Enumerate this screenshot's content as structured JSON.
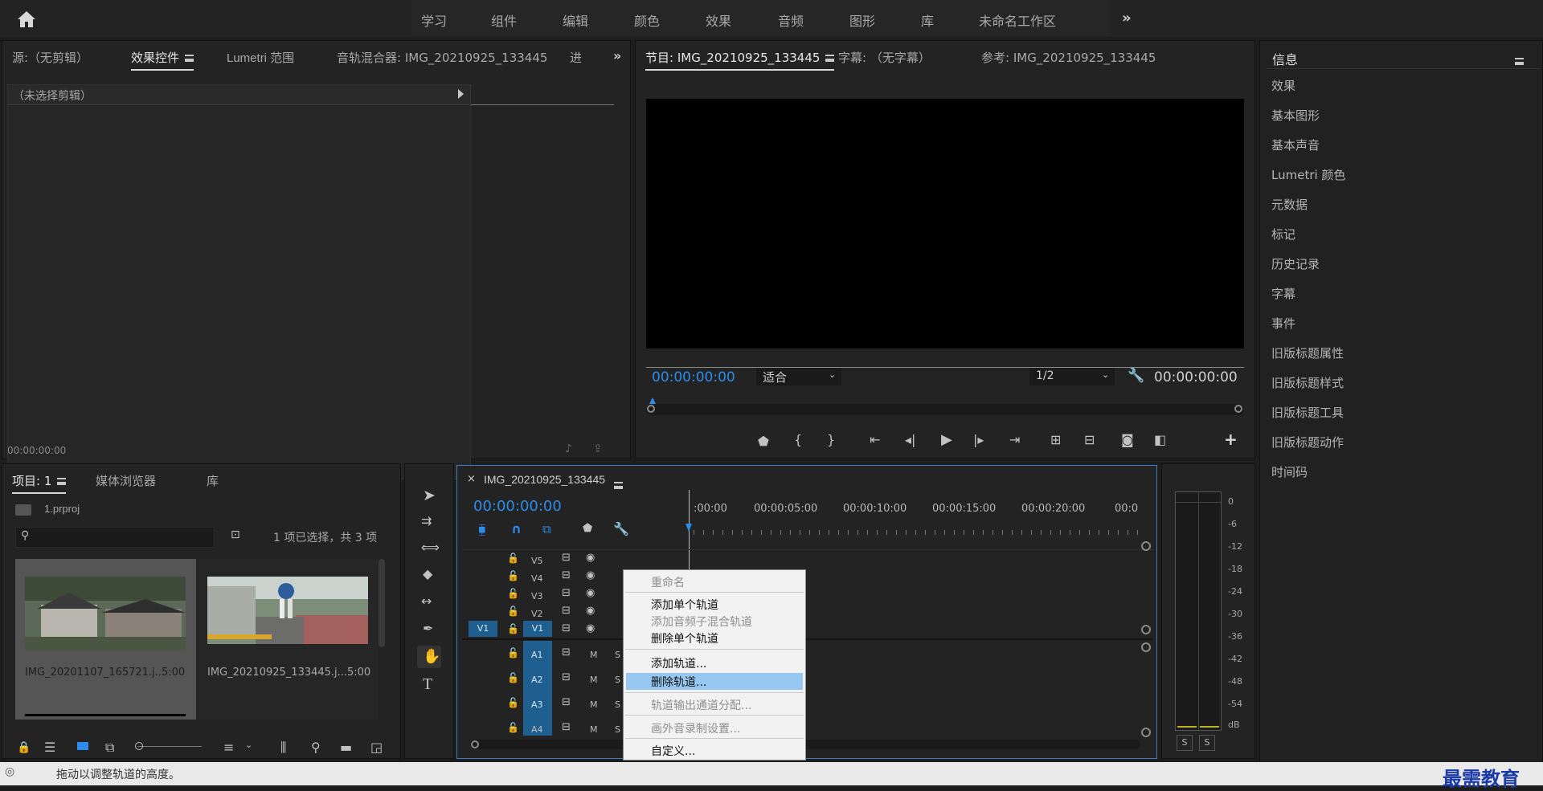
{
  "workspaces": {
    "tabs": [
      "学习",
      "组件",
      "编辑",
      "颜色",
      "效果",
      "音频",
      "图形",
      "库",
      "未命名工作区"
    ],
    "more": "»"
  },
  "source_panel": {
    "tabs": [
      "源:（无剪辑）",
      "效果控件",
      "Lumetri 范围",
      "音轨混合器: IMG_20210925_133445",
      "进"
    ],
    "more": "»",
    "no_clip": "（未选择剪辑）",
    "timecode": "00:00:00:00"
  },
  "program_panel": {
    "tabs": [
      "节目: IMG_20210925_133445",
      "字幕: （无字幕）",
      "参考: IMG_20210925_133445"
    ],
    "timecode_left": "00:00:00:00",
    "fit": "适合",
    "resolution": "1/2",
    "timecode_right": "00:00:00:00"
  },
  "right_panel": {
    "title": "信息",
    "items": [
      "效果",
      "基本图形",
      "基本声音",
      "Lumetri 颜色",
      "元数据",
      "标记",
      "历史记录",
      "字幕",
      "事件",
      "旧版标题属性",
      "旧版标题样式",
      "旧版标题工具",
      "旧版标题动作",
      "时间码"
    ]
  },
  "project_panel": {
    "tabs": [
      "项目: 1",
      "媒体浏览器",
      "库"
    ],
    "file": "1.prproj",
    "selection_info": "1 项已选择，共 3 项",
    "search_placeholder": "",
    "items": [
      {
        "name": "IMG_20201107_165721.j...",
        "duration": "5:00"
      },
      {
        "name": "IMG_20210925_133445.j...",
        "duration": "5:00"
      }
    ]
  },
  "timeline": {
    "tab": "IMG_20210925_133445",
    "close": "×",
    "timecode": "00:00:00:00",
    "ruler": [
      ":00:00",
      "00:00:05:00",
      "00:00:10:00",
      "00:00:15:00",
      "00:00:20:00",
      "00:0"
    ],
    "video_tracks": [
      "V5",
      "V4",
      "V3",
      "V2",
      "V1"
    ],
    "source_patch": "V1",
    "audio_tracks": [
      "A1",
      "A2",
      "A3",
      "A4"
    ],
    "mute": "M",
    "solo": "S"
  },
  "context_menu": {
    "items": [
      {
        "label": "重命名",
        "enabled": false
      },
      {
        "label": "添加单个轨道",
        "enabled": true
      },
      {
        "label": "添加音频子混合轨道",
        "enabled": false
      },
      {
        "label": "删除单个轨道",
        "enabled": true
      },
      {
        "label": "添加轨道...",
        "enabled": true
      },
      {
        "label": "删除轨道...",
        "enabled": true,
        "highlighted": true
      },
      {
        "label": "轨道输出通道分配...",
        "enabled": false
      },
      {
        "label": "画外音录制设置...",
        "enabled": false
      },
      {
        "label": "自定义...",
        "enabled": true
      }
    ]
  },
  "audio_meter": {
    "scale": [
      "0",
      "-6",
      "-12",
      "-18",
      "-24",
      "-30",
      "-36",
      "-42",
      "-48",
      "-54",
      "dB"
    ],
    "solo_buttons": [
      "S",
      "S"
    ]
  },
  "status_bar": {
    "text": "拖动以调整轨道的高度。"
  },
  "watermark": "最需教育",
  "colors": {
    "accent_blue": "#2d8ceb",
    "track_blue": "#1f5f8f",
    "highlight": "#96c8f1",
    "timeline_border": "#3b7fc4"
  }
}
